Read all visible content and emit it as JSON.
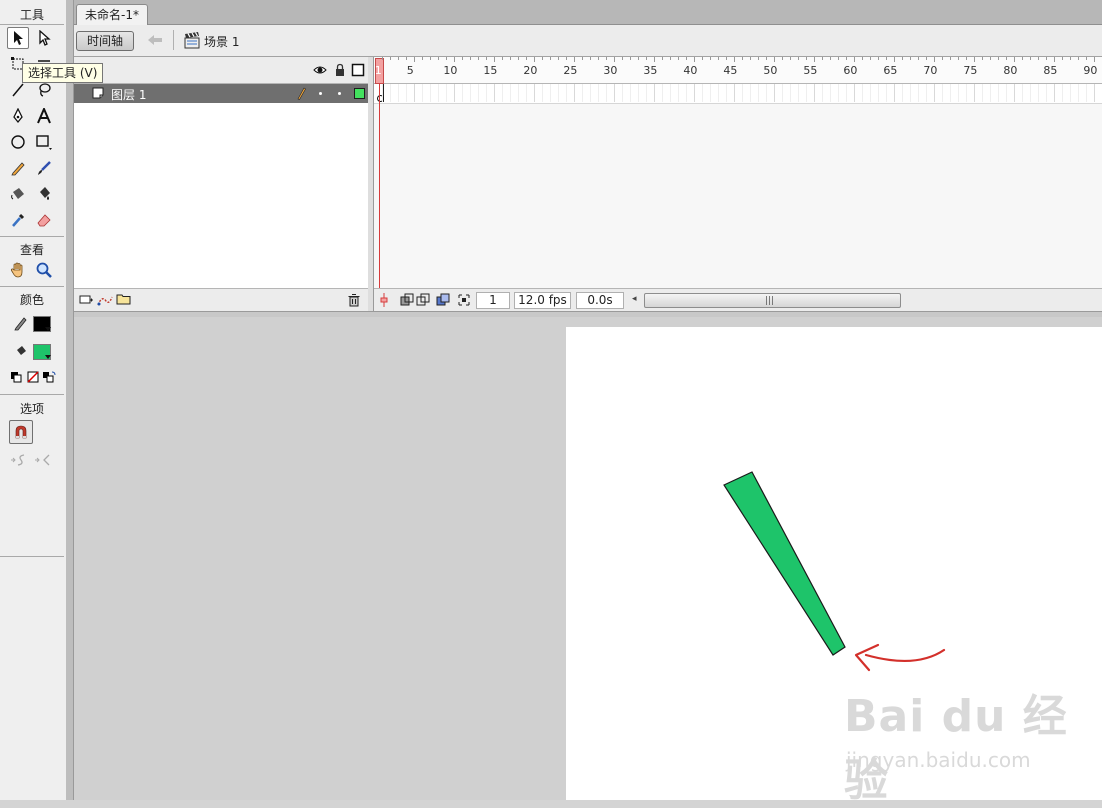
{
  "toolbox": {
    "title": "工具",
    "view_title": "查看",
    "color_title": "颜色",
    "options_title": "选项",
    "tooltip": "选择工具 (V)",
    "stroke_color": "#000000",
    "fill_color": "#1ec46a"
  },
  "document": {
    "tab_title": "未命名-1*"
  },
  "editbar": {
    "timeline_button": "时间轴",
    "scene_label": "场景 1"
  },
  "timeline": {
    "layer_name": "图层 1",
    "layer_color": "#43e05e",
    "ruler_numbers": [
      "1",
      "5",
      "10",
      "15",
      "20",
      "25",
      "30",
      "35",
      "40",
      "45",
      "50",
      "55",
      "60",
      "65",
      "70",
      "75",
      "80",
      "85",
      "90"
    ],
    "current_frame": "1",
    "fps": "12.0 fps",
    "elapsed": "0.0s"
  },
  "stage": {
    "shape_fill": "#1ec46a",
    "annotation_color": "#d3302b"
  },
  "watermark": {
    "logo": "Bai du 经验",
    "url": "jingyan.baidu.com"
  }
}
